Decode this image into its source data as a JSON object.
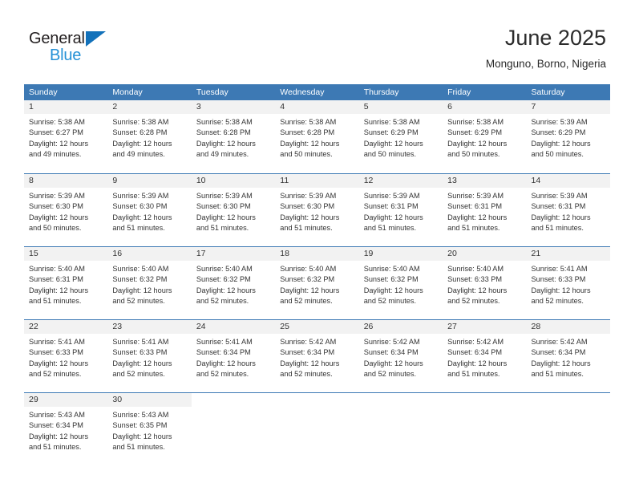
{
  "logo": {
    "word_one": "General",
    "word_two": "Blue",
    "triangle_color": "#1271ba",
    "blue_color": "#2591d6"
  },
  "header": {
    "title": "June 2025",
    "subtitle": "Monguno, Borno, Nigeria"
  },
  "calendar": {
    "accent_color": "#3d79b4",
    "daynum_band_color": "#f2f2f2",
    "weekday_headers": [
      "Sunday",
      "Monday",
      "Tuesday",
      "Wednesday",
      "Thursday",
      "Friday",
      "Saturday"
    ],
    "weeks": [
      [
        {
          "day": "1",
          "sunrise": "Sunrise: 5:38 AM",
          "sunset": "Sunset: 6:27 PM",
          "daylight_line1": "Daylight: 12 hours",
          "daylight_line2": "and 49 minutes."
        },
        {
          "day": "2",
          "sunrise": "Sunrise: 5:38 AM",
          "sunset": "Sunset: 6:28 PM",
          "daylight_line1": "Daylight: 12 hours",
          "daylight_line2": "and 49 minutes."
        },
        {
          "day": "3",
          "sunrise": "Sunrise: 5:38 AM",
          "sunset": "Sunset: 6:28 PM",
          "daylight_line1": "Daylight: 12 hours",
          "daylight_line2": "and 49 minutes."
        },
        {
          "day": "4",
          "sunrise": "Sunrise: 5:38 AM",
          "sunset": "Sunset: 6:28 PM",
          "daylight_line1": "Daylight: 12 hours",
          "daylight_line2": "and 50 minutes."
        },
        {
          "day": "5",
          "sunrise": "Sunrise: 5:38 AM",
          "sunset": "Sunset: 6:29 PM",
          "daylight_line1": "Daylight: 12 hours",
          "daylight_line2": "and 50 minutes."
        },
        {
          "day": "6",
          "sunrise": "Sunrise: 5:38 AM",
          "sunset": "Sunset: 6:29 PM",
          "daylight_line1": "Daylight: 12 hours",
          "daylight_line2": "and 50 minutes."
        },
        {
          "day": "7",
          "sunrise": "Sunrise: 5:39 AM",
          "sunset": "Sunset: 6:29 PM",
          "daylight_line1": "Daylight: 12 hours",
          "daylight_line2": "and 50 minutes."
        }
      ],
      [
        {
          "day": "8",
          "sunrise": "Sunrise: 5:39 AM",
          "sunset": "Sunset: 6:30 PM",
          "daylight_line1": "Daylight: 12 hours",
          "daylight_line2": "and 50 minutes."
        },
        {
          "day": "9",
          "sunrise": "Sunrise: 5:39 AM",
          "sunset": "Sunset: 6:30 PM",
          "daylight_line1": "Daylight: 12 hours",
          "daylight_line2": "and 51 minutes."
        },
        {
          "day": "10",
          "sunrise": "Sunrise: 5:39 AM",
          "sunset": "Sunset: 6:30 PM",
          "daylight_line1": "Daylight: 12 hours",
          "daylight_line2": "and 51 minutes."
        },
        {
          "day": "11",
          "sunrise": "Sunrise: 5:39 AM",
          "sunset": "Sunset: 6:30 PM",
          "daylight_line1": "Daylight: 12 hours",
          "daylight_line2": "and 51 minutes."
        },
        {
          "day": "12",
          "sunrise": "Sunrise: 5:39 AM",
          "sunset": "Sunset: 6:31 PM",
          "daylight_line1": "Daylight: 12 hours",
          "daylight_line2": "and 51 minutes."
        },
        {
          "day": "13",
          "sunrise": "Sunrise: 5:39 AM",
          "sunset": "Sunset: 6:31 PM",
          "daylight_line1": "Daylight: 12 hours",
          "daylight_line2": "and 51 minutes."
        },
        {
          "day": "14",
          "sunrise": "Sunrise: 5:39 AM",
          "sunset": "Sunset: 6:31 PM",
          "daylight_line1": "Daylight: 12 hours",
          "daylight_line2": "and 51 minutes."
        }
      ],
      [
        {
          "day": "15",
          "sunrise": "Sunrise: 5:40 AM",
          "sunset": "Sunset: 6:31 PM",
          "daylight_line1": "Daylight: 12 hours",
          "daylight_line2": "and 51 minutes."
        },
        {
          "day": "16",
          "sunrise": "Sunrise: 5:40 AM",
          "sunset": "Sunset: 6:32 PM",
          "daylight_line1": "Daylight: 12 hours",
          "daylight_line2": "and 52 minutes."
        },
        {
          "day": "17",
          "sunrise": "Sunrise: 5:40 AM",
          "sunset": "Sunset: 6:32 PM",
          "daylight_line1": "Daylight: 12 hours",
          "daylight_line2": "and 52 minutes."
        },
        {
          "day": "18",
          "sunrise": "Sunrise: 5:40 AM",
          "sunset": "Sunset: 6:32 PM",
          "daylight_line1": "Daylight: 12 hours",
          "daylight_line2": "and 52 minutes."
        },
        {
          "day": "19",
          "sunrise": "Sunrise: 5:40 AM",
          "sunset": "Sunset: 6:32 PM",
          "daylight_line1": "Daylight: 12 hours",
          "daylight_line2": "and 52 minutes."
        },
        {
          "day": "20",
          "sunrise": "Sunrise: 5:40 AM",
          "sunset": "Sunset: 6:33 PM",
          "daylight_line1": "Daylight: 12 hours",
          "daylight_line2": "and 52 minutes."
        },
        {
          "day": "21",
          "sunrise": "Sunrise: 5:41 AM",
          "sunset": "Sunset: 6:33 PM",
          "daylight_line1": "Daylight: 12 hours",
          "daylight_line2": "and 52 minutes."
        }
      ],
      [
        {
          "day": "22",
          "sunrise": "Sunrise: 5:41 AM",
          "sunset": "Sunset: 6:33 PM",
          "daylight_line1": "Daylight: 12 hours",
          "daylight_line2": "and 52 minutes."
        },
        {
          "day": "23",
          "sunrise": "Sunrise: 5:41 AM",
          "sunset": "Sunset: 6:33 PM",
          "daylight_line1": "Daylight: 12 hours",
          "daylight_line2": "and 52 minutes."
        },
        {
          "day": "24",
          "sunrise": "Sunrise: 5:41 AM",
          "sunset": "Sunset: 6:34 PM",
          "daylight_line1": "Daylight: 12 hours",
          "daylight_line2": "and 52 minutes."
        },
        {
          "day": "25",
          "sunrise": "Sunrise: 5:42 AM",
          "sunset": "Sunset: 6:34 PM",
          "daylight_line1": "Daylight: 12 hours",
          "daylight_line2": "and 52 minutes."
        },
        {
          "day": "26",
          "sunrise": "Sunrise: 5:42 AM",
          "sunset": "Sunset: 6:34 PM",
          "daylight_line1": "Daylight: 12 hours",
          "daylight_line2": "and 52 minutes."
        },
        {
          "day": "27",
          "sunrise": "Sunrise: 5:42 AM",
          "sunset": "Sunset: 6:34 PM",
          "daylight_line1": "Daylight: 12 hours",
          "daylight_line2": "and 51 minutes."
        },
        {
          "day": "28",
          "sunrise": "Sunrise: 5:42 AM",
          "sunset": "Sunset: 6:34 PM",
          "daylight_line1": "Daylight: 12 hours",
          "daylight_line2": "and 51 minutes."
        }
      ],
      [
        {
          "day": "29",
          "sunrise": "Sunrise: 5:43 AM",
          "sunset": "Sunset: 6:34 PM",
          "daylight_line1": "Daylight: 12 hours",
          "daylight_line2": "and 51 minutes."
        },
        {
          "day": "30",
          "sunrise": "Sunrise: 5:43 AM",
          "sunset": "Sunset: 6:35 PM",
          "daylight_line1": "Daylight: 12 hours",
          "daylight_line2": "and 51 minutes."
        },
        {
          "day": "",
          "sunrise": "",
          "sunset": "",
          "daylight_line1": "",
          "daylight_line2": ""
        },
        {
          "day": "",
          "sunrise": "",
          "sunset": "",
          "daylight_line1": "",
          "daylight_line2": ""
        },
        {
          "day": "",
          "sunrise": "",
          "sunset": "",
          "daylight_line1": "",
          "daylight_line2": ""
        },
        {
          "day": "",
          "sunrise": "",
          "sunset": "",
          "daylight_line1": "",
          "daylight_line2": ""
        },
        {
          "day": "",
          "sunrise": "",
          "sunset": "",
          "daylight_line1": "",
          "daylight_line2": ""
        }
      ]
    ]
  }
}
